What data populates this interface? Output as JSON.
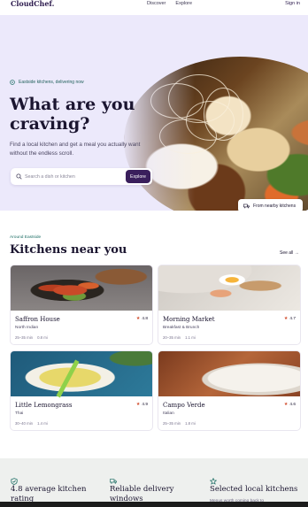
{
  "brand": {
    "logo": "CloudChef."
  },
  "nav": {
    "links": [
      "Discover",
      "Explore"
    ],
    "signin": "Sign in"
  },
  "hero": {
    "tag": "Eastside kitchens, delivering now",
    "title": "What are you craving?",
    "subtitle": "Find a local kitchen and get a meal you actually want without the endless scroll.",
    "search_placeholder": "Search a dish or kitchen",
    "search_button": "Explore",
    "nearby_button": "From nearby kitchens"
  },
  "kitchens": {
    "eyebrow": "Around Eastside",
    "title": "Kitchens near you",
    "see_all": "See all →",
    "cards": [
      {
        "name": "Saffron House",
        "cuisine": "North Indian",
        "time": "25–35 min",
        "distance": "0.8 mi",
        "rating": "4.8"
      },
      {
        "name": "Morning Market",
        "cuisine": "Breakfast & Brunch",
        "time": "20–35 min",
        "distance": "1.1 mi",
        "rating": "4.7"
      },
      {
        "name": "Little Lemongrass",
        "cuisine": "Thai",
        "time": "30–40 min",
        "distance": "1.4 mi",
        "rating": "4.9"
      },
      {
        "name": "Campo Verde",
        "cuisine": "Italian",
        "time": "25–35 min",
        "distance": "1.8 mi",
        "rating": "4.6"
      }
    ]
  },
  "features": [
    {
      "icon": "shield-check-icon",
      "title": "4.8 average kitchen rating",
      "desc": ""
    },
    {
      "icon": "truck-icon",
      "title": "Reliable delivery windows",
      "desc": ""
    },
    {
      "icon": "star-icon",
      "title": "Selected local kitchens",
      "desc": "Menus worth coming back to"
    }
  ],
  "colors": {
    "accent": "#3a1f5c",
    "hero_bg": "#ece9fb",
    "teal": "#1f6f66",
    "star": "#d04a2a"
  }
}
